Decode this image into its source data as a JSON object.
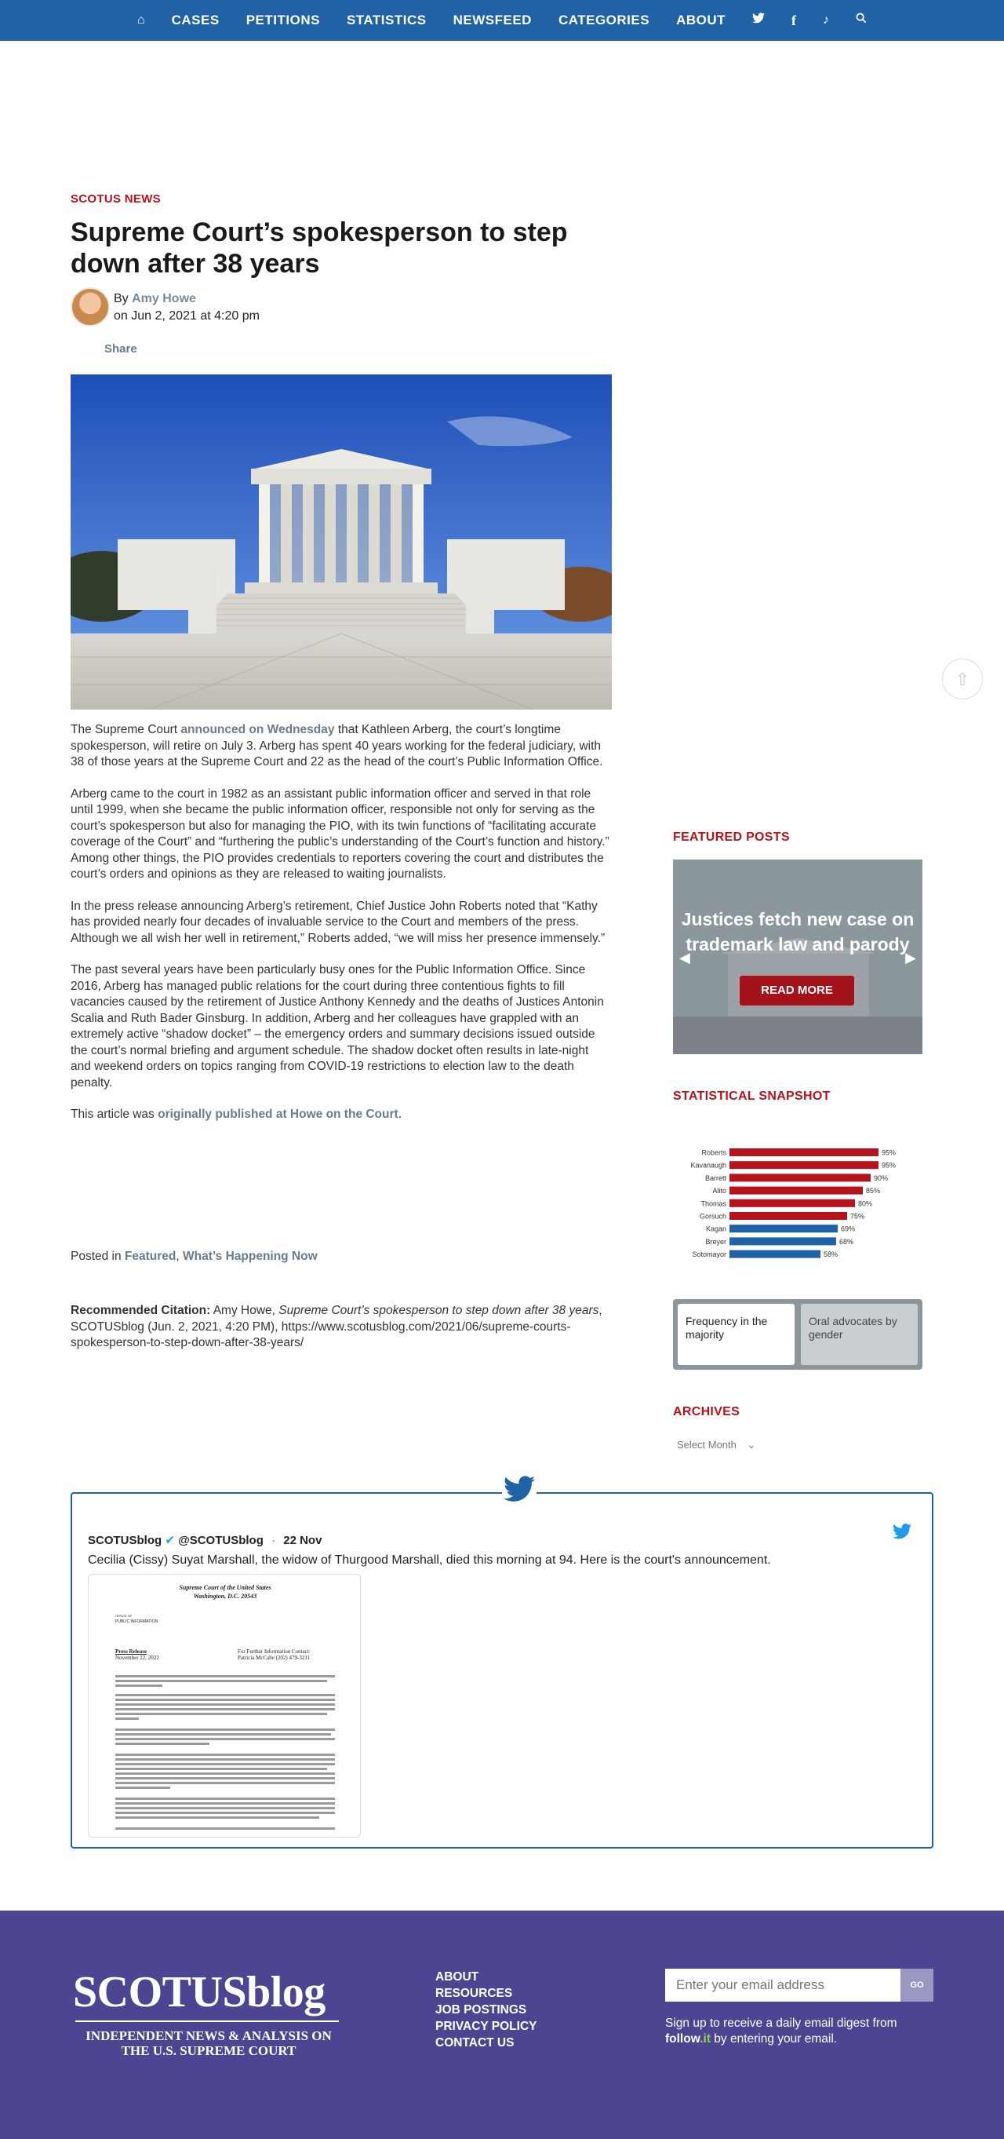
{
  "nav": {
    "items": [
      "CASES",
      "PETITIONS",
      "STATISTICS",
      "NEWSFEED",
      "CATEGORIES",
      "ABOUT"
    ],
    "icons": [
      "home-icon",
      "twitter-icon",
      "facebook-icon",
      "tiktok-icon",
      "search-icon"
    ]
  },
  "article": {
    "category": "SCOTUS NEWS",
    "title": "Supreme Court’s spokesperson to step down after 38 years",
    "by_prefix": "By",
    "author": "Amy Howe",
    "date": "on Jun 2, 2021 at 4:20 pm",
    "share": "Share",
    "p1_a": "The Supreme Court ",
    "p1_link": "announced on Wednesday",
    "p1_b": " that Kathleen Arberg, the court’s longtime spokesperson, will retire on July 3. Arberg has spent 40 years working for the federal judiciary, with 38 of those years at the Supreme Court and 22 as the head of the court’s Public Information Office.",
    "p2": "Arberg came to the court in 1982 as an assistant public information officer and served in that role until 1999, when she became the public information officer, responsible not only for serving as the court’s spokesperson but also for managing the PIO, with its twin functions of “facilitating accurate coverage of the Court” and “furthering the public’s understanding of the Court’s function and history.” Among other things, the PIO provides credentials to reporters covering the court and distributes the court’s orders and opinions as they are released to waiting journalists.",
    "p3": "In the press release announcing Arberg’s retirement, Chief Justice John Roberts noted that “Kathy has provided nearly four decades of invaluable service to the Court and members of the press. Although we all wish her well in retirement,” Roberts added, “we will miss her presence immensely.”",
    "p4": "The past several years have been particularly busy ones for the Public Information Office. Since 2016, Arberg has managed public relations for the court during three contentious fights to fill vacancies caused by the retirement of Justice Anthony Kennedy and the deaths of Justices Antonin Scalia and Ruth Bader Ginsburg. In addition, Arberg and her colleagues have grappled with an extremely active “shadow docket” – the emergency orders and summary decisions issued outside the court’s normal briefing and argument schedule. The shadow docket often results in late-night and weekend orders on topics ranging from COVID-19 restrictions to election law to the death penalty.",
    "p5_a": "This article was ",
    "p5_link": "originally published at Howe on the Court",
    "p5_b": ".",
    "posted_prefix": "Posted in ",
    "posted_cat1": "Featured",
    "posted_sep": ", ",
    "posted_cat2": "What’s Happening Now",
    "citation_label": "Recommended Citation:",
    "citation_a": " Amy Howe, ",
    "citation_title": "Supreme Court’s spokesperson to step down after 38 years",
    "citation_b": ", SCOTUSblog (Jun. 2, 2021, 4:20 PM), https://www.scotusblog.com/2021/06/supreme-courts-spokesperson-to-step-down-after-38-years/"
  },
  "sidebar": {
    "featured_heading": "FEATURED POSTS",
    "featured_text": "Justices fetch new case on trademark law and parody",
    "read_more": "READ MORE",
    "snapshot_heading": "STATISTICAL SNAPSHOT",
    "tab_active": "Frequency in the majority",
    "tab_inactive": "Oral advocates by gender",
    "archives_heading": "ARCHIVES",
    "archives_select": "Select Month"
  },
  "chart_data": {
    "type": "bar",
    "categories": [
      "Roberts",
      "Kavanaugh",
      "Barrett",
      "Alito",
      "Thomas",
      "Gorsuch",
      "Kagan",
      "Breyer",
      "Sotomayor"
    ],
    "values": [
      95,
      95,
      90,
      85,
      80,
      75,
      69,
      68,
      58
    ],
    "value_labels": [
      "95%",
      "95%",
      "90%",
      "85%",
      "80%",
      "75%",
      "69%",
      "68%",
      "58%"
    ],
    "colors": [
      "#b5121b",
      "#b5121b",
      "#b5121b",
      "#b5121b",
      "#b5121b",
      "#b5121b",
      "#1f62a6",
      "#1f62a6",
      "#1f62a6"
    ],
    "xlim": [
      0,
      100
    ]
  },
  "tweet": {
    "name": "SCOTUSblog",
    "handle": "@SCOTUSblog",
    "dot": "·",
    "date": "22 Nov",
    "text": "Cecilia (Cissy) Suyat Marshall, the widow of Thurgood Marshall, died this morning at 94. Here is the court's announcement.",
    "doc_header1": "Supreme Court of the United States",
    "doc_header2": "Washington, D.C. 20543",
    "doc_office1": "OFFICE OF",
    "doc_office2": "PUBLIC INFORMATION",
    "doc_release": "Press Release",
    "doc_date": "November 22, 2022",
    "doc_contact1": "For Further Information Contact:",
    "doc_contact2": "Patricia McCabe (202) 479-3211"
  },
  "footer": {
    "logo": "SCOTUSblog",
    "tagline": "INDEPENDENT NEWS & ANALYSIS ON THE U.S. SUPREME COURT",
    "links": [
      "ABOUT",
      "RESOURCES",
      "JOB POSTINGS",
      "PRIVACY POLICY",
      "CONTACT US"
    ],
    "email_placeholder": "Enter your email address",
    "go": "GO",
    "signup_a": "Sign up to receive a daily email digest from ",
    "signup_follow": "follow",
    "signup_it": ".it",
    "signup_b": " by entering your email."
  },
  "colors": {
    "nav": "#1f62a6",
    "accent_red": "#b5121b",
    "footer": "#4b4592",
    "link_gray": "#6b7b8a"
  }
}
